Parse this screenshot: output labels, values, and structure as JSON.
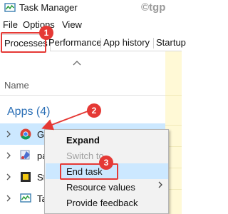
{
  "window": {
    "title": "Task Manager",
    "watermark": "©tgp",
    "icon": "task-manager-icon"
  },
  "menu": {
    "file": "File",
    "options": "Options",
    "view": "View"
  },
  "tabs": [
    {
      "label": "Processes",
      "active": true
    },
    {
      "label": "Performance",
      "active": false
    },
    {
      "label": "App history",
      "active": false
    },
    {
      "label": "Startup",
      "active": false
    }
  ],
  "list": {
    "column_header": "Name",
    "sort_indicator": "chevron-up-icon",
    "group": "Apps (4)",
    "rows": [
      {
        "label": "G",
        "icon": "chrome-icon",
        "selected": true
      },
      {
        "label": "pa",
        "icon": "paint-icon",
        "selected": false
      },
      {
        "label": "St",
        "icon": "sticky-notes-icon",
        "selected": false
      },
      {
        "label": "Ta",
        "icon": "task-manager-icon",
        "selected": false
      }
    ]
  },
  "context_menu": {
    "items": [
      {
        "label": "Expand",
        "bold": true,
        "enabled": true
      },
      {
        "label": "Switch to",
        "bold": false,
        "enabled": false
      },
      {
        "label": "End task",
        "bold": false,
        "enabled": true,
        "highlighted": true
      },
      {
        "label": "Resource values",
        "bold": false,
        "enabled": true,
        "submenu": true
      },
      {
        "label": "Provide feedback",
        "bold": false,
        "enabled": true
      }
    ]
  },
  "annotations": {
    "badges": [
      "1",
      "2",
      "3"
    ],
    "color": "#e53935"
  },
  "colors": {
    "group_text": "#2b6fb6",
    "selection": "#cce8ff",
    "cpu_column": "#fff9d6"
  }
}
